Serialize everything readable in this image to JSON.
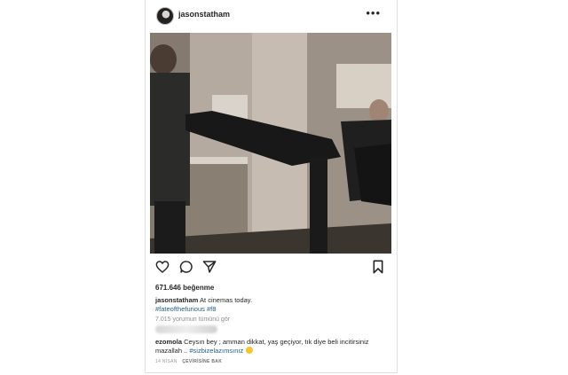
{
  "post": {
    "username": "jasonstatham",
    "more_label": "•••",
    "likes": "671.646 beğenme",
    "caption_user": "jasonstatham",
    "caption_text": "At cinemas today.",
    "hashtags": "#fateofthefurious #f8",
    "view_comments": "7.015 yorumun tümünü gör",
    "comment": {
      "user": "ezomola",
      "text": "Ceysın bey ; amman dikkat, yaş geçiyor, tık diye beli incitirsiniz mazallah ..",
      "hashtag": "#sizbizelazımsınız"
    },
    "date": "14 NİSAN",
    "translate": "ÇEVİRİSİNE BAK"
  },
  "icons": [
    "heart-icon",
    "comment-icon",
    "share-icon",
    "bookmark-icon"
  ],
  "colors": {
    "link": "#1f5e8f",
    "text": "#262626",
    "muted": "#8e8e8e"
  }
}
